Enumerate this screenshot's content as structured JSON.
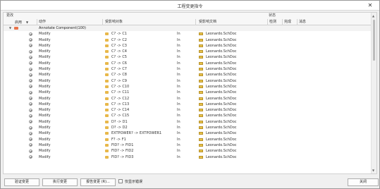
{
  "window": {
    "title": "工程变更指令",
    "close_glyph": "✕"
  },
  "group_headers": {
    "changes": "更改",
    "status": "状态"
  },
  "columns": {
    "enable": "启用",
    "action": "动作",
    "affected_object": "受影响对象",
    "affected_document": "受影响文档",
    "check": "检测",
    "done": "完成",
    "message": "消息"
  },
  "group_row": {
    "label": "Annotate Component(100)"
  },
  "rows": [
    {
      "action": "Modify",
      "object": "C? -> C1",
      "in": "In",
      "document": "Leonardo.SchDoc"
    },
    {
      "action": "Modify",
      "object": "C? -> C2",
      "in": "In",
      "document": "Leonardo.SchDoc"
    },
    {
      "action": "Modify",
      "object": "C? -> C3",
      "in": "In",
      "document": "Leonardo.SchDoc"
    },
    {
      "action": "Modify",
      "object": "C? -> C4",
      "in": "In",
      "document": "Leonardo.SchDoc"
    },
    {
      "action": "Modify",
      "object": "C? -> C5",
      "in": "In",
      "document": "Leonardo.SchDoc"
    },
    {
      "action": "Modify",
      "object": "C? -> C6",
      "in": "In",
      "document": "Leonardo.SchDoc"
    },
    {
      "action": "Modify",
      "object": "C? -> C7",
      "in": "In",
      "document": "Leonardo.SchDoc"
    },
    {
      "action": "Modify",
      "object": "C? -> C8",
      "in": "In",
      "document": "Leonardo.SchDoc"
    },
    {
      "action": "Modify",
      "object": "C? -> C9",
      "in": "In",
      "document": "Leonardo.SchDoc"
    },
    {
      "action": "Modify",
      "object": "C? -> C10",
      "in": "In",
      "document": "Leonardo.SchDoc"
    },
    {
      "action": "Modify",
      "object": "C? -> C11",
      "in": "In",
      "document": "Leonardo.SchDoc"
    },
    {
      "action": "Modify",
      "object": "C? -> C12",
      "in": "In",
      "document": "Leonardo.SchDoc"
    },
    {
      "action": "Modify",
      "object": "C? -> C13",
      "in": "In",
      "document": "Leonardo.SchDoc"
    },
    {
      "action": "Modify",
      "object": "C? -> C14",
      "in": "In",
      "document": "Leonardo.SchDoc"
    },
    {
      "action": "Modify",
      "object": "C? -> C15",
      "in": "In",
      "document": "Leonardo.SchDoc"
    },
    {
      "action": "Modify",
      "object": "D? -> D1",
      "in": "In",
      "document": "Leonardo.SchDoc"
    },
    {
      "action": "Modify",
      "object": "D? -> D2",
      "in": "In",
      "document": "Leonardo.SchDoc"
    },
    {
      "action": "Modify",
      "object": "EXTPOWER? -> EXTPOWER1",
      "in": "In",
      "document": "Leonardo.SchDoc"
    },
    {
      "action": "Modify",
      "object": "F? -> F1",
      "in": "In",
      "document": "Leonardo.SchDoc"
    },
    {
      "action": "Modify",
      "object": "FID? -> FID1",
      "in": "In",
      "document": "Leonardo.SchDoc"
    },
    {
      "action": "Modify",
      "object": "FID? -> FID2",
      "in": "In",
      "document": "Leonardo.SchDoc"
    },
    {
      "action": "Modify",
      "object": "FID? -> FID3",
      "in": "In",
      "document": "Leonardo.SchDoc"
    }
  ],
  "footer": {
    "validate": "验证变更",
    "execute": "执行变更",
    "report": "报告变更 (R)...",
    "only_errors": "仅显示错误",
    "close": "关闭"
  },
  "icons": {
    "expand": "chevron-down-icon",
    "folder": "folder-icon",
    "check": "check-circle-icon",
    "component": "component-icon",
    "document": "schematic-doc-icon"
  }
}
